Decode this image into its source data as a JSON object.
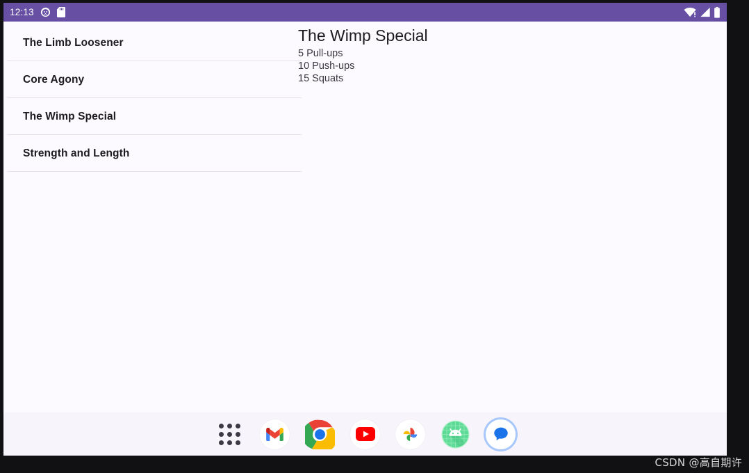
{
  "status_bar": {
    "clock": "12:13",
    "left_icons": [
      {
        "name": "notification-cat-icon",
        "glyph": "cat"
      },
      {
        "name": "sd-card-icon",
        "glyph": "sd-card"
      }
    ],
    "right_icons": [
      {
        "name": "wifi-alert-icon",
        "glyph": "wifi-exclamation"
      },
      {
        "name": "cell-signal-icon",
        "glyph": "signal-bars"
      },
      {
        "name": "battery-icon",
        "glyph": "battery-full"
      }
    ],
    "background_color": "#6750A4",
    "foreground_color": "#FFFFFF"
  },
  "workout_list": {
    "items": [
      {
        "label": "The Limb Loosener"
      },
      {
        "label": "Core Agony"
      },
      {
        "label": "The Wimp Special"
      },
      {
        "label": "Strength and Length"
      }
    ],
    "selected_index": 2
  },
  "detail": {
    "title": "The Wimp Special",
    "lines": [
      "5 Pull-ups",
      "10 Push-ups",
      "15 Squats"
    ]
  },
  "dock": {
    "items": [
      {
        "name": "app-drawer",
        "label": "All apps"
      },
      {
        "name": "gmail",
        "label": "Gmail"
      },
      {
        "name": "chrome",
        "label": "Chrome"
      },
      {
        "name": "youtube",
        "label": "YouTube"
      },
      {
        "name": "photos",
        "label": "Photos"
      },
      {
        "name": "android-emulator",
        "label": "Android"
      },
      {
        "name": "messages",
        "label": "Messages"
      }
    ],
    "background_color": "#F8F4FB",
    "highlight_ring_color": "#A8C7FA"
  },
  "watermark": {
    "text": "CSDN @高自期许"
  }
}
